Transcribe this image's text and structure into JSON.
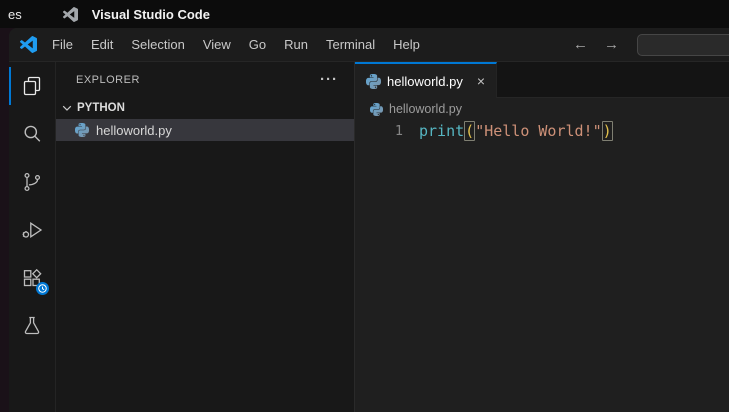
{
  "topbar": {
    "activities_partial": "es",
    "app_title": "Visual Studio Code"
  },
  "menubar": {
    "items": [
      "File",
      "Edit",
      "Selection",
      "View",
      "Go",
      "Run",
      "Terminal",
      "Help"
    ],
    "back_arrow": "←",
    "forward_arrow": "→",
    "search_value": ""
  },
  "activity_bar": {
    "items": [
      {
        "id": "explorer",
        "label": "Explorer",
        "icon": "files-icon",
        "active": true
      },
      {
        "id": "search",
        "label": "Search",
        "icon": "search-icon",
        "active": false
      },
      {
        "id": "source-control",
        "label": "Source Control",
        "icon": "source-control-icon",
        "active": false
      },
      {
        "id": "run-debug",
        "label": "Run and Debug",
        "icon": "debug-icon",
        "active": false
      },
      {
        "id": "extensions",
        "label": "Extensions",
        "icon": "extensions-icon",
        "active": false,
        "badge": "clock-badge-icon"
      },
      {
        "id": "testing",
        "label": "Testing",
        "icon": "beaker-icon",
        "active": false
      }
    ]
  },
  "sidebar": {
    "title": "EXPLORER",
    "actions_glyph": "···",
    "section": "PYTHON",
    "files": [
      {
        "name": "helloworld.py",
        "icon": "python-icon",
        "selected": true
      }
    ]
  },
  "editor": {
    "tab": {
      "label": "helloworld.py",
      "icon": "python-icon",
      "close_glyph": "×"
    },
    "breadcrumb": {
      "file": "helloworld.py",
      "icon": "python-icon"
    },
    "code": {
      "line_number": "1",
      "tokens": {
        "function": "print",
        "paren_open": "(",
        "string": "\"Hello World!\"",
        "paren_close": ")"
      }
    }
  },
  "colors": {
    "accent": "#0078d4",
    "function-color": "#56b6c2",
    "string-color": "#ce9178",
    "bracket-color": "#e2c14d",
    "vscode-blue": "#1f9cf0"
  }
}
